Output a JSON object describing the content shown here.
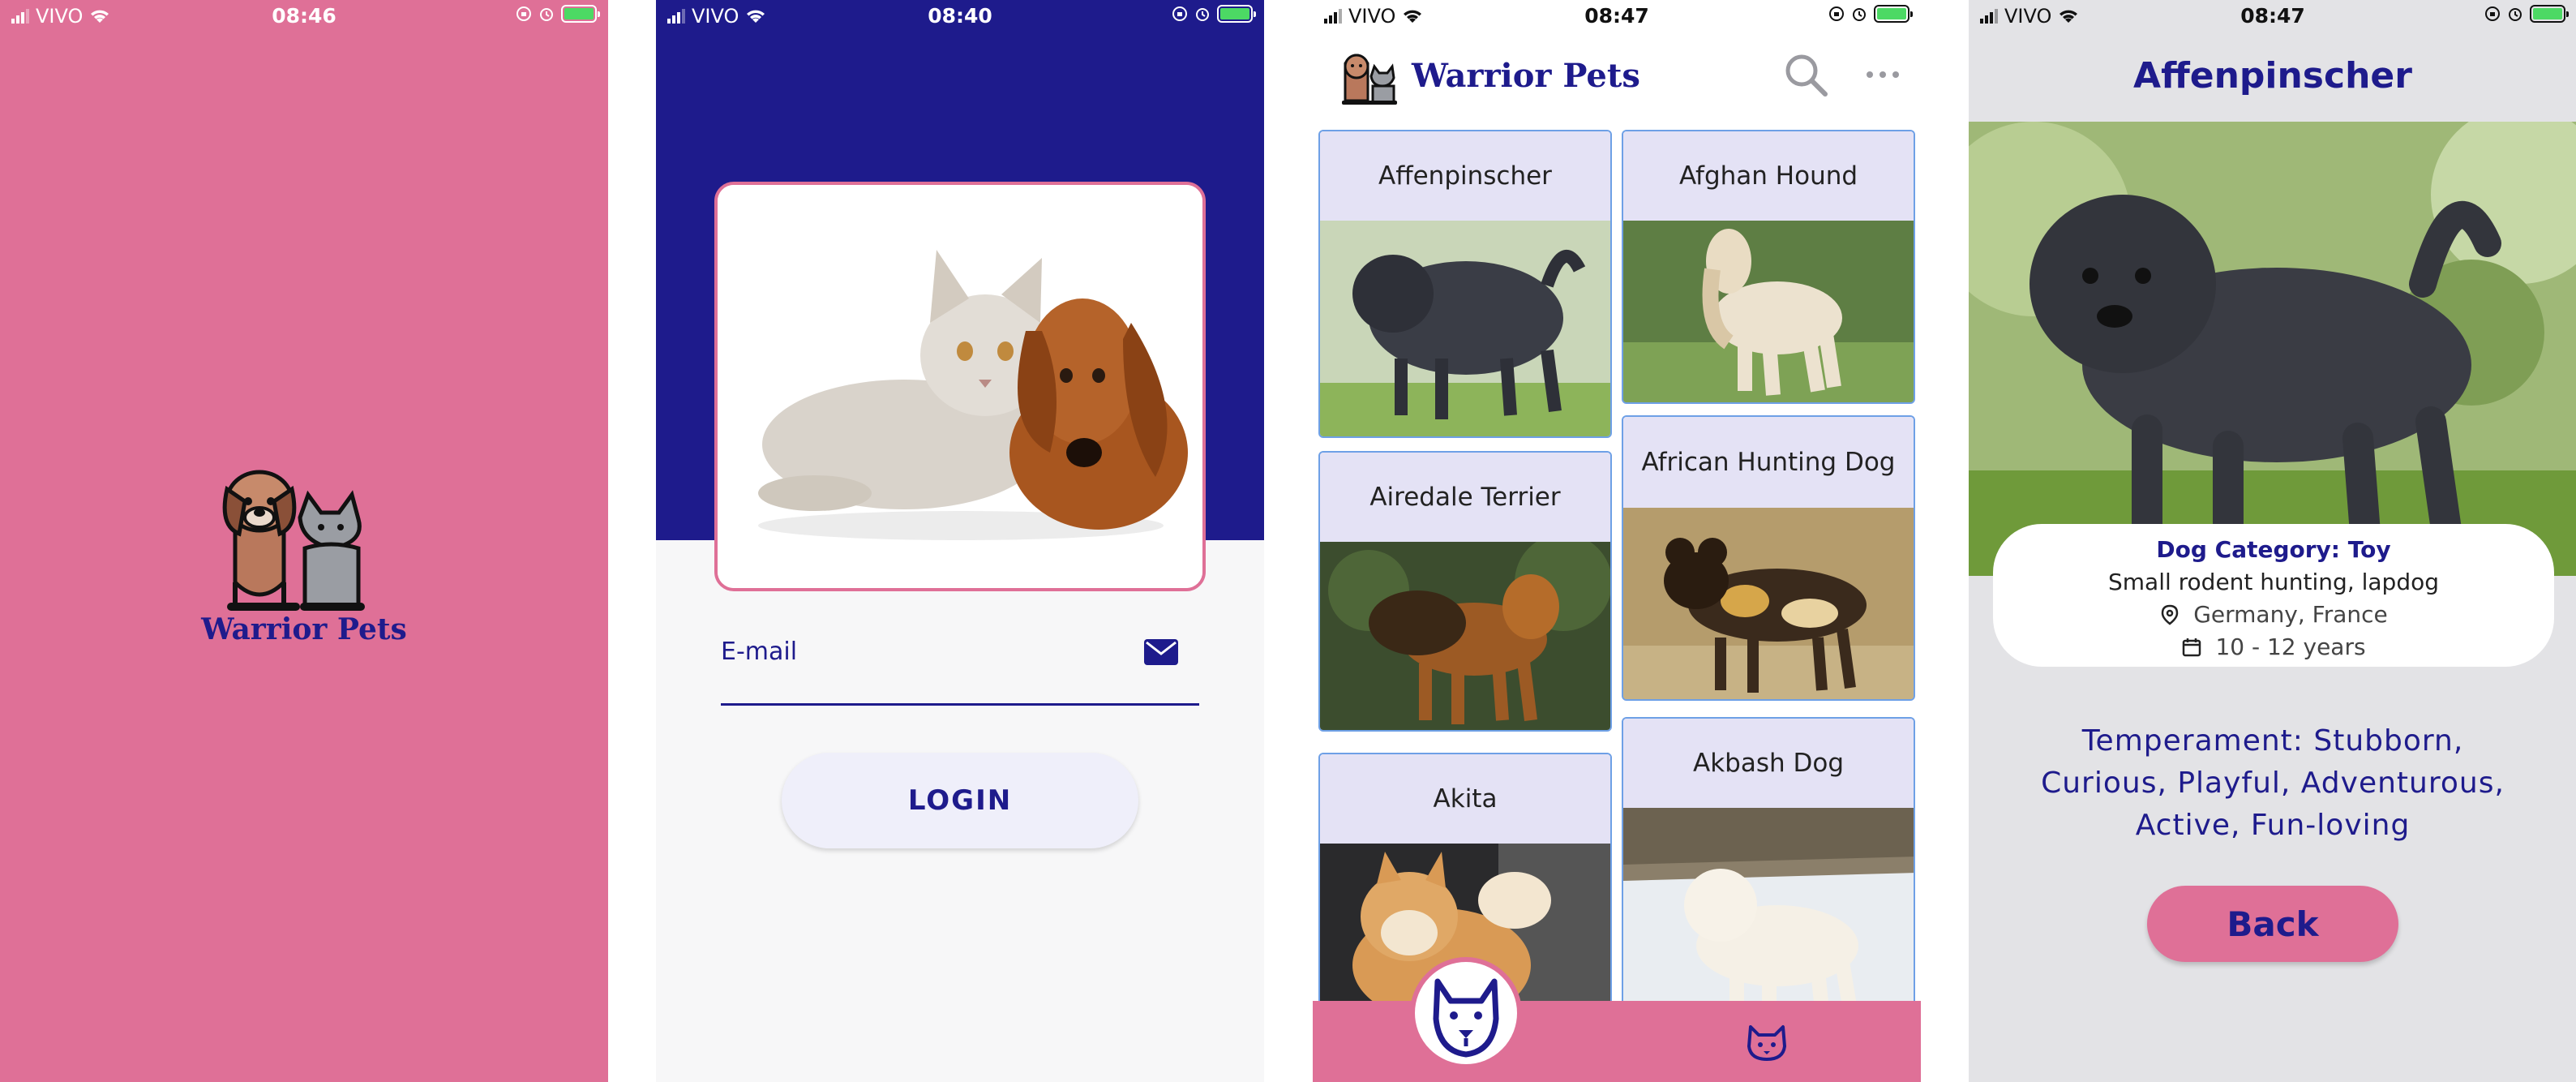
{
  "status": {
    "carrier": "VIVO",
    "s1_time": "08:46",
    "s2_time": "08:40",
    "s3_time": "08:47",
    "s4_time": "08:47"
  },
  "splash": {
    "app_name": "Warrior Pets"
  },
  "login": {
    "email_label": "E-mail",
    "login_button": "LOGIN"
  },
  "list": {
    "app_title": "Warrior Pets",
    "breeds": [
      "Affenpinscher",
      "Afghan Hound",
      "Airedale Terrier",
      "African Hunting Dog",
      "Akita",
      "Akbash Dog"
    ]
  },
  "detail": {
    "title": "Affenpinscher",
    "category": "Dog Category: Toy",
    "bred_for": "Small rodent hunting, lapdog",
    "origin": "Germany, France",
    "life_span": "10 - 12 years",
    "temperament": "Temperament: Stubborn, Curious, Playful, Adventurous, Active, Fun-loving",
    "back_button": "Back"
  },
  "colors": {
    "pink": "#df7097",
    "navy": "#1e1b8c",
    "card_header": "#e4e2f5",
    "card_border": "#6ea0e6"
  }
}
